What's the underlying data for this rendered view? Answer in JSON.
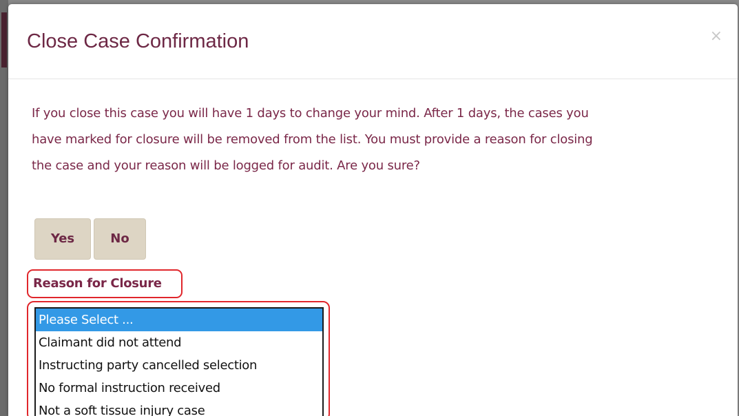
{
  "modal": {
    "title": "Close Case Confirmation",
    "close_glyph": "×",
    "message_lines": [
      "If you close this case you will have 1 days to change your mind. After 1 days, the cases you",
      "have marked for closure will be removed from the list. You must provide a reason for closing",
      "the case and your reason will be logged for audit. Are you sure?"
    ],
    "buttons": {
      "yes_label": "Yes",
      "no_label": "No"
    },
    "reason": {
      "label": "Reason for Closure",
      "selected_value": "Please Select ...",
      "options": [
        "Please Select ...",
        "Claimant did not attend",
        "Instructing party cancelled selection",
        "No formal instruction received",
        "Not a soft tissue injury case"
      ]
    }
  },
  "colors": {
    "title": "#6d2845",
    "message_text": "#7a2748",
    "button_bg": "#ddd5c4",
    "selected_option_bg": "#3399e6",
    "highlight_outline": "#e0262b"
  }
}
